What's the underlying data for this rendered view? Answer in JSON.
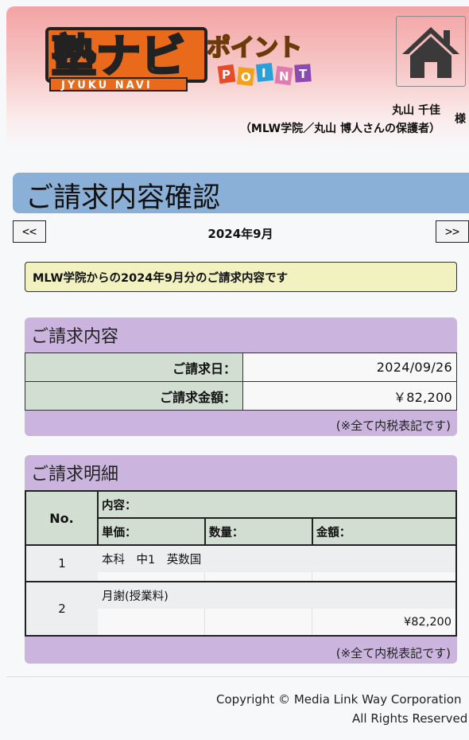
{
  "header": {
    "logo_text": "塾ナビ",
    "logo_sub": "JYUKU NAVI",
    "logo_point_jp": "ポイント",
    "logo_point_letters": [
      "P",
      "O",
      "I",
      "N",
      "T"
    ],
    "user_name": "丸山 千佳",
    "user_sub": "（MLW学院／丸山 博人さんの保護者）",
    "honorific": "様"
  },
  "page_title": "ご請求内容確認",
  "nav": {
    "prev": "<<",
    "next": ">>",
    "month": "2024年9月"
  },
  "notice": "MLW学院からの2024年9月分のご請求内容です",
  "summary": {
    "title": "ご請求内容",
    "date_label": "ご請求日：",
    "date_value": "2024/09/26",
    "amount_label": "ご請求金額：",
    "amount_value": "￥82,200",
    "tax_note": "(※全て内税表記です)"
  },
  "detail": {
    "title": "ご請求明細",
    "headers": {
      "no": "No.",
      "content": "内容：",
      "unit_price": "単価：",
      "quantity": "数量：",
      "amount": "金額："
    },
    "rows": [
      {
        "no": "1",
        "content": "本科　中1　英数国",
        "unit_price": "",
        "quantity": "",
        "amount": ""
      },
      {
        "no": "2",
        "content": "月謝(授業料)",
        "unit_price": "",
        "quantity": "",
        "amount": "¥82,200"
      }
    ],
    "tax_note": "(※全て内税表記です)"
  },
  "footer": {
    "copyright": "Copyright © Media Link Way Corporation",
    "rights": "All Rights Reserved"
  },
  "colors": {
    "title_bar": "#8ab0d8",
    "panel": "#cbb5de",
    "label_cell": "#d3ded3",
    "notice": "#f2f2c0",
    "header_gradient_top": "#f3a3a3"
  }
}
